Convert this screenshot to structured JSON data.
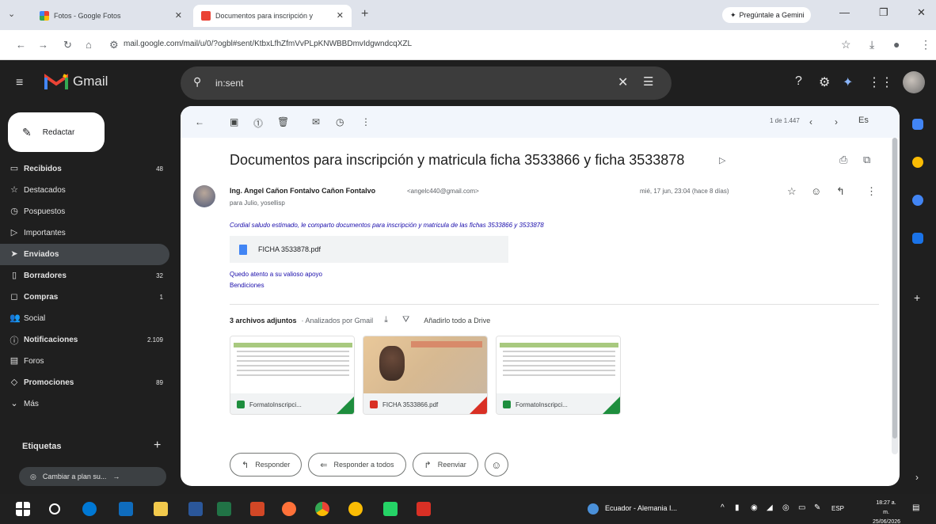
{
  "browser": {
    "tabs": [
      {
        "title": "Fotos - Google Fotos",
        "active": false
      },
      {
        "title": "Documentos para inscripción y",
        "active": true
      }
    ],
    "gemini_label": "Pregúntale a Gemini",
    "url": "mail.google.com/mail/u/0/?ogbl#sent/KtbxLfhZfmVvPLpKNWBBDmvIdgwndcqXZL"
  },
  "gmail": {
    "app_name": "Gmail",
    "search_value": "in:sent",
    "compose_label": "Redactar",
    "nav": [
      {
        "icon": "inbox-icon",
        "glyph": "▭",
        "label": "Recibidos",
        "count": "48",
        "bold": true,
        "selected": false
      },
      {
        "icon": "star-icon",
        "glyph": "☆",
        "label": "Destacados",
        "count": "",
        "bold": false,
        "selected": false
      },
      {
        "icon": "clock-icon",
        "glyph": "◷",
        "label": "Pospuestos",
        "count": "",
        "bold": false,
        "selected": false
      },
      {
        "icon": "label-important-icon",
        "glyph": "▷",
        "label": "Importantes",
        "count": "",
        "bold": false,
        "selected": false
      },
      {
        "icon": "send-icon",
        "glyph": "➤",
        "label": "Enviados",
        "count": "",
        "bold": true,
        "selected": true
      },
      {
        "icon": "draft-icon",
        "glyph": "▯",
        "label": "Borradores",
        "count": "32",
        "bold": true,
        "selected": false
      },
      {
        "icon": "shopping-icon",
        "glyph": "◻",
        "label": "Compras",
        "count": "1",
        "bold": true,
        "selected": false
      },
      {
        "icon": "people-icon",
        "glyph": "👥",
        "label": "Social",
        "count": "",
        "bold": false,
        "selected": false
      },
      {
        "icon": "info-icon",
        "glyph": "ⓘ",
        "label": "Notificaciones",
        "count": "2.109",
        "bold": true,
        "selected": false
      },
      {
        "icon": "forum-icon",
        "glyph": "▤",
        "label": "Foros",
        "count": "",
        "bold": false,
        "selected": false
      },
      {
        "icon": "tag-icon",
        "glyph": "◇",
        "label": "Promociones",
        "count": "89",
        "bold": true,
        "selected": false
      },
      {
        "icon": "chevron-down-icon",
        "glyph": "⌄",
        "label": "Más",
        "count": "",
        "bold": false,
        "selected": false
      }
    ],
    "labels_heading": "Etiquetas",
    "upgrade_label": "Cambiar a plan su..."
  },
  "email": {
    "pager": "1 de 1.447",
    "lang": "Es",
    "subject": "Documentos para inscripción y matricula ficha 3533866 y ficha 3533878",
    "sender_name": "Ing. Angel Cañon Fontalvo Cañon Fontalvo",
    "sender_email": "<angelc440@gmail.com>",
    "to": "para Julio, yosellisp",
    "date": "mié, 17 jun, 23:04 (hace 8 días)",
    "body_line": "Cordial saludo estimado, le comparto documentos para inscripción y matricula de las fichas 3533866 y 3533878",
    "inline_attachment": "FICHA 3533878.pdf",
    "closing1": "Quedo atento a su valioso apoyo",
    "closing2": "Bendiciones",
    "attachments_count": "3 archivos adjuntos",
    "scanned_by": "· Analizados por Gmail",
    "add_all_drive": "Añadirlo todo a Drive",
    "attachments": [
      {
        "name": "FormatoInscripci...",
        "type": "sheet"
      },
      {
        "name": "FICHA 3533866.pdf",
        "type": "pdf"
      },
      {
        "name": "FormatoInscripci...",
        "type": "sheet"
      }
    ],
    "reply": "Responder",
    "reply_all": "Responder a todos",
    "forward": "Reenviar"
  },
  "taskbar": {
    "weather": "Ecuador - Alemania I...",
    "lang": "ESP",
    "time": "18:27 a. m.",
    "date": "25/06/2026"
  },
  "colors": {
    "dark_bg": "#1f1f1f",
    "selected_nav": "#414549",
    "link_blue": "#1a0dab"
  }
}
